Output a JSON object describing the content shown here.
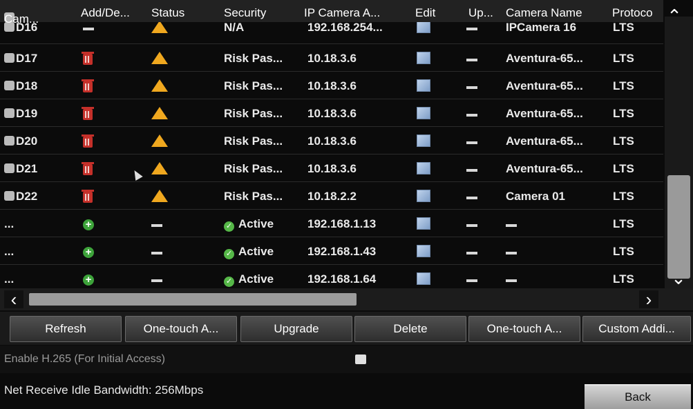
{
  "headers": {
    "camera": "Cam...",
    "add_delete": "Add/De...",
    "status": "Status",
    "security": "Security",
    "ip": "IP Camera A...",
    "edit": "Edit",
    "upgrade": "Up...",
    "camera_name": "Camera Name",
    "protocol": "Protoco"
  },
  "rows": [
    {
      "camera": "D16",
      "security": "N/A",
      "ip": "192.168.254...",
      "name": "IPCamera 16",
      "protocol": "LTS"
    },
    {
      "camera": "D17",
      "security": "Risk Pas...",
      "ip": "10.18.3.6",
      "name": "Aventura-65...",
      "protocol": "LTS"
    },
    {
      "camera": "D18",
      "security": "Risk Pas...",
      "ip": "10.18.3.6",
      "name": "Aventura-65...",
      "protocol": "LTS"
    },
    {
      "camera": "D19",
      "security": "Risk Pas...",
      "ip": "10.18.3.6",
      "name": "Aventura-65...",
      "protocol": "LTS"
    },
    {
      "camera": "D20",
      "security": "Risk Pas...",
      "ip": "10.18.3.6",
      "name": "Aventura-65...",
      "protocol": "LTS"
    },
    {
      "camera": "D21",
      "security": "Risk Pas...",
      "ip": "10.18.3.6",
      "name": "Aventura-65...",
      "protocol": "LTS"
    },
    {
      "camera": "D22",
      "security": "Risk Pas...",
      "ip": "10.18.2.2",
      "name": "Camera 01",
      "protocol": "LTS"
    },
    {
      "camera": "...",
      "security": "Active",
      "ip": "192.168.1.13",
      "name": "",
      "protocol": "LTS"
    },
    {
      "camera": "...",
      "security": "Active",
      "ip": "192.168.1.43",
      "name": "",
      "protocol": "LTS"
    },
    {
      "camera": "...",
      "security": "Active",
      "ip": "192.168.1.64",
      "name": "",
      "protocol": "LTS"
    }
  ],
  "buttons": {
    "refresh": "Refresh",
    "one_touch_1": "One-touch A...",
    "upgrade": "Upgrade",
    "delete": "Delete",
    "one_touch_2": "One-touch A...",
    "custom_add": "Custom Addi..."
  },
  "options": {
    "h265_label": "Enable H.265 (For Initial Access)"
  },
  "footer": {
    "bandwidth": "Net Receive Idle Bandwidth: 256Mbps",
    "back": "Back"
  },
  "colors": {
    "warning": "#f0a81f",
    "delete": "#c5302a",
    "add": "#3da33a",
    "active": "#56b848"
  }
}
